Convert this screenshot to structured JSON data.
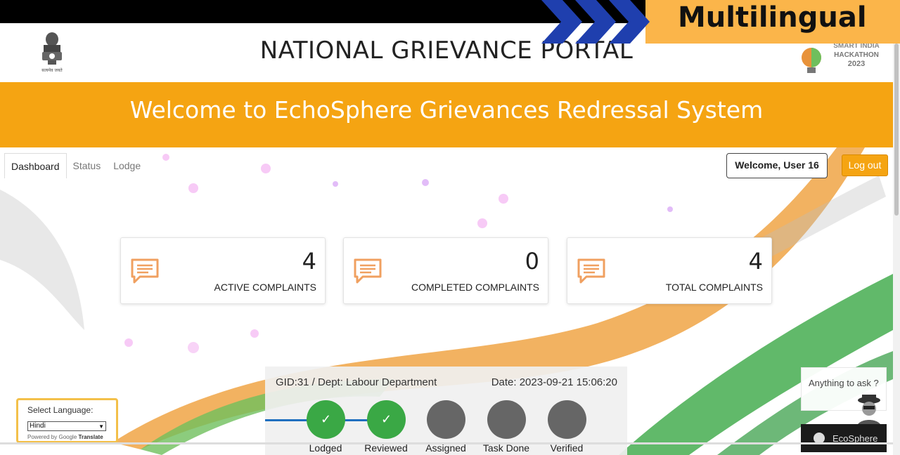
{
  "overlay": {
    "banner_text": "Multilingual"
  },
  "header": {
    "emblem_caption": "सत्यमेव जयते",
    "title": "NATIONAL GRIEVANCE PORTAL",
    "sih_logo": {
      "line1": "SMART INDIA",
      "line2": "HACKATHON",
      "line3": "2023"
    }
  },
  "welcome_band": {
    "text": "Welcome to EchoSphere Grievances Redressal System"
  },
  "nav": {
    "tabs": [
      {
        "label": "Dashboard",
        "active": true
      },
      {
        "label": "Status",
        "active": false
      },
      {
        "label": "Lodge",
        "active": false
      }
    ],
    "welcome_user": "Welcome, User 16",
    "logout_label": "Log out"
  },
  "stats": [
    {
      "value": "4",
      "label": "ACTIVE COMPLAINTS",
      "icon": "message-icon"
    },
    {
      "value": "0",
      "label": "COMPLETED COMPLAINTS",
      "icon": "message-icon"
    },
    {
      "value": "4",
      "label": "TOTAL COMPLAINTS",
      "icon": "message-icon"
    }
  ],
  "tracking": {
    "gid_dept": "GID:31 / Dept: Labour Department",
    "date": "Date: 2023-09-21 15:06:20",
    "steps": [
      {
        "label": "Lodged",
        "done": true,
        "mark": "✓"
      },
      {
        "label": "Reviewed",
        "done": true,
        "mark": "✓"
      },
      {
        "label": "Assigned",
        "done": false,
        "mark": ""
      },
      {
        "label": "Task Done",
        "done": false,
        "mark": ""
      },
      {
        "label": "Verified",
        "done": false,
        "mark": ""
      }
    ]
  },
  "language": {
    "label": "Select Language:",
    "selected": "Hindi",
    "powered_prefix": "Powered by",
    "powered_google": "Google",
    "powered_suffix": "Translate"
  },
  "chat": {
    "prompt": "Anything to ask ?",
    "bar_label": "EcoSphere"
  },
  "colors": {
    "accent": "#f5a412",
    "done": "#3aa845",
    "pending": "#666666",
    "line": "#1f6fbf"
  }
}
